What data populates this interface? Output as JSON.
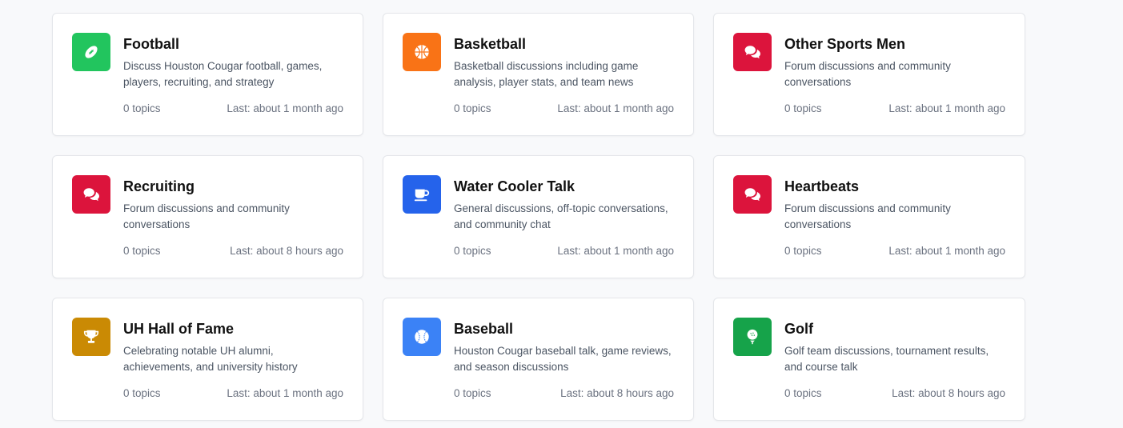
{
  "forums": [
    {
      "title": "Football",
      "description": "Discuss Houston Cougar football, games, players, recruiting, and strategy",
      "topics": "0 topics",
      "last": "Last: about 1 month ago",
      "icon": "football-icon",
      "color": "#22c55e"
    },
    {
      "title": "Basketball",
      "description": "Basketball discussions including game analysis, player stats, and team news",
      "topics": "0 topics",
      "last": "Last: about 1 month ago",
      "icon": "basketball-icon",
      "color": "#f97316"
    },
    {
      "title": "Other Sports Men",
      "description": "Forum discussions and community conversations",
      "topics": "0 topics",
      "last": "Last: about 1 month ago",
      "icon": "chat-bubbles-icon",
      "color": "#dc143c"
    },
    {
      "title": "Recruiting",
      "description": "Forum discussions and community conversations",
      "topics": "0 topics",
      "last": "Last: about 8 hours ago",
      "icon": "chat-bubbles-icon",
      "color": "#dc143c"
    },
    {
      "title": "Water Cooler Talk",
      "description": "General discussions, off-topic conversations, and community chat",
      "topics": "0 topics",
      "last": "Last: about 1 month ago",
      "icon": "coffee-cup-icon",
      "color": "#2563eb"
    },
    {
      "title": "Heartbeats",
      "description": "Forum discussions and community conversations",
      "topics": "0 topics",
      "last": "Last: about 1 month ago",
      "icon": "chat-bubbles-icon",
      "color": "#dc143c"
    },
    {
      "title": "UH Hall of Fame",
      "description": "Celebrating notable UH alumni, achievements, and university history",
      "topics": "0 topics",
      "last": "Last: about 1 month ago",
      "icon": "trophy-icon",
      "color": "#ca8a04"
    },
    {
      "title": "Baseball",
      "description": "Houston Cougar baseball talk, game reviews, and season discussions",
      "topics": "0 topics",
      "last": "Last: about 8 hours ago",
      "icon": "baseball-icon",
      "color": "#3b82f6"
    },
    {
      "title": "Golf",
      "description": "Golf team discussions, tournament results, and course talk",
      "topics": "0 topics",
      "last": "Last: about 8 hours ago",
      "icon": "golf-ball-icon",
      "color": "#16a34a"
    }
  ]
}
